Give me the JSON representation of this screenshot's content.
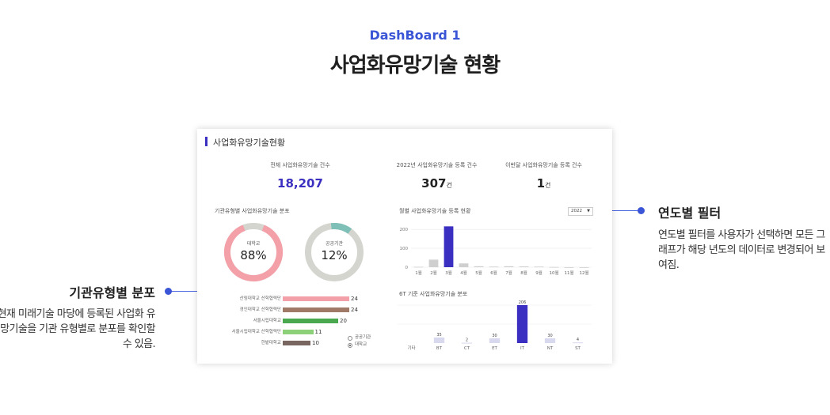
{
  "hero": {
    "subtitle": "DashBoard 1",
    "title": "사업화유망기술 현황"
  },
  "callouts": {
    "right": {
      "title": "연도별 필터",
      "desc": "연도별 필터를 사용자가 선택하면 모든 그래프가 해당 년도의 데이터로 변경되어 보여짐."
    },
    "left": {
      "title": "기관유형별 분포",
      "desc": "현재 미래기술 마당에 등록된 사업화 유망기술을 기관 유형별로 분포를 확인할 수 있음."
    }
  },
  "card": {
    "title": "사업화유망기술현황",
    "stats": [
      {
        "label": "전체 사업화유망기술 건수",
        "value": "18,207",
        "unit": ""
      },
      {
        "label": "2022년 사업화유망기술 등록 건수",
        "value": "307",
        "unit": "건"
      },
      {
        "label": "이번달 사업화유망기술 등록 건수",
        "value": "1",
        "unit": "건"
      }
    ],
    "dist_label": "기관유형별 사업화유망기술 분포",
    "monthly_label": "월별 사업화유망기술 등록 현황",
    "sixT_label": "6T 기준 사업화유망기술 분포",
    "year_select": "2022",
    "legend": {
      "item1": "공공기관",
      "item2": "대학교"
    }
  },
  "colors": {
    "accent": "#3a2fc0",
    "pink": "#f4a0a8",
    "teal": "#7ec0b8",
    "grey": "#d5d5d0",
    "brown": "#a07a66",
    "green": "#4aa84e",
    "lightgreen": "#8cd07a",
    "darkbrown": "#7a6660"
  },
  "chart_data": [
    {
      "type": "pie",
      "categories": [
        "대학교"
      ],
      "values": [
        88
      ],
      "labels": [
        "88%"
      ]
    },
    {
      "type": "pie",
      "categories": [
        "공공기관"
      ],
      "values": [
        12
      ],
      "labels": [
        "12%"
      ]
    },
    {
      "type": "bar",
      "orientation": "horizontal",
      "categories": [
        "산림대학교 산학협력단",
        "경인대학교 산학협력단",
        "서울시립대학교",
        "서울시립대학교 산학협력단",
        "한밭대학교"
      ],
      "values": [
        24,
        24,
        20,
        11,
        10
      ],
      "colors": [
        "#f4a0a8",
        "#a07a66",
        "#4aa84e",
        "#8cd07a",
        "#7a6660"
      ]
    },
    {
      "type": "bar",
      "categories": [
        "1월",
        "2월",
        "3월",
        "4월",
        "5월",
        "6월",
        "7월",
        "8월",
        "9월",
        "10월",
        "11월",
        "12월"
      ],
      "values": [
        2,
        40,
        216,
        20,
        5,
        3,
        5,
        4,
        3,
        1,
        0,
        0
      ],
      "highlight": 2,
      "yticks": [
        0,
        100,
        200
      ],
      "ylim": [
        0,
        230
      ]
    },
    {
      "type": "bar",
      "categories": [
        "기타",
        "BT",
        "CT",
        "ET",
        "IT",
        "NT",
        "ST"
      ],
      "values": [
        0,
        35,
        2,
        30,
        206,
        30,
        4
      ],
      "value_labels": [
        "",
        "35",
        "2",
        "30",
        "206",
        "30",
        "4"
      ],
      "highlight": 4
    }
  ]
}
